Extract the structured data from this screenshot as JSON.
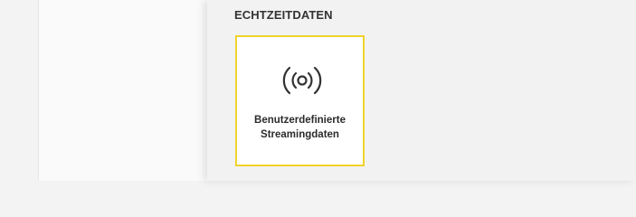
{
  "section": {
    "title": "ECHTZEITDATEN"
  },
  "tiles": [
    {
      "icon": "broadcast-signal-icon",
      "label_line1": "Benutzerdefinierte",
      "label_line2": "Streamingdaten"
    }
  ],
  "colors": {
    "accent": "#f0d22a",
    "text": "#2b2b2b",
    "panel_bg": "#f2f2f2"
  }
}
